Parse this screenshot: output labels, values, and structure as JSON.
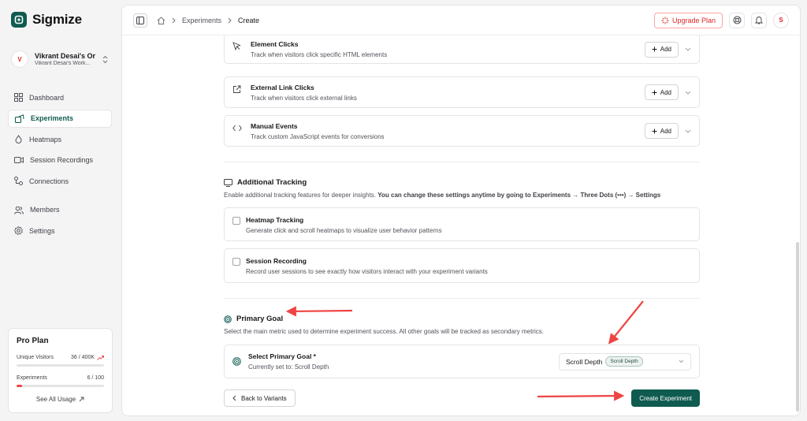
{
  "app": {
    "name": "Sigmize"
  },
  "org": {
    "initial": "V",
    "name": "Vikrant Desai's Or...",
    "workspace": "Vikrant Desai's Work..."
  },
  "nav": [
    {
      "label": "Dashboard",
      "icon": "dashboard-icon"
    },
    {
      "label": "Experiments",
      "icon": "experiments-icon",
      "active": true
    },
    {
      "label": "Heatmaps",
      "icon": "heatmaps-icon"
    },
    {
      "label": "Session Recordings",
      "icon": "video-icon"
    },
    {
      "label": "Connections",
      "icon": "connections-icon"
    },
    {
      "label": "Members",
      "icon": "members-icon"
    },
    {
      "label": "Settings",
      "icon": "gear-icon"
    }
  ],
  "plan": {
    "title": "Pro Plan",
    "visitors_label": "Unique Visitors",
    "visitors_value": "36 / 400K",
    "visitors_fraction": 9e-05,
    "experiments_label": "Experiments",
    "experiments_value": "6 / 100",
    "experiments_fraction": 0.06,
    "see_all": "See All Usage"
  },
  "breadcrumb": {
    "section": "Experiments",
    "current": "Create"
  },
  "topbar": {
    "upgrade": "Upgrade Plan",
    "user_initial": "S"
  },
  "events": [
    {
      "title": "Element Clicks",
      "desc": "Track when visitors click specific HTML elements",
      "add": "Add"
    },
    {
      "title": "External Link Clicks",
      "desc": "Track when visitors click external links",
      "add": "Add"
    },
    {
      "title": "Manual Events",
      "desc": "Track custom JavaScript events for conversions",
      "add": "Add"
    }
  ],
  "tracking": {
    "title": "Additional Tracking",
    "desc": "Enable additional tracking features for deeper insights.",
    "desc_bold": "You can change these settings anytime by going to Experiments → Three Dots (•••) → Settings",
    "options": [
      {
        "title": "Heatmap Tracking",
        "desc": "Generate click and scroll heatmaps to visualize user behavior patterns"
      },
      {
        "title": "Session Recording",
        "desc": "Record user sessions to see exactly how visitors interact with your experiment variants"
      }
    ]
  },
  "goal": {
    "title": "Primary Goal",
    "desc": "Select the main metric used to determine experiment success. All other goals will be tracked as secondary metrics.",
    "select_label": "Select Primary Goal *",
    "current": "Currently set to: Scroll Depth",
    "selected_value": "Scroll Depth",
    "selected_badge": "Scroll Depth"
  },
  "actions": {
    "back": "Back to Variants",
    "create": "Create Experiment"
  },
  "colors": {
    "brand": "#0f5b4f",
    "accent_red": "#dc2626",
    "annotation_arrow": "#ef4444"
  }
}
